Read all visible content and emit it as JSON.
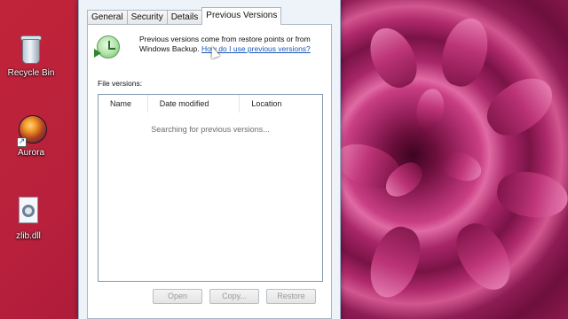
{
  "desktop": {
    "icons": [
      {
        "label": "Recycle Bin",
        "icon": "recycle-bin-icon"
      },
      {
        "label": "Aurora",
        "icon": "aurora-app-icon"
      },
      {
        "label": "zlib.dll",
        "icon": "dll-file-icon"
      }
    ],
    "wallpaper_colors": [
      "#b8203b",
      "#9c2460",
      "#e06aa3"
    ]
  },
  "window": {
    "tabs": [
      {
        "label": "General",
        "active": false
      },
      {
        "label": "Security",
        "active": false
      },
      {
        "label": "Details",
        "active": false
      },
      {
        "label": "Previous Versions",
        "active": true
      }
    ],
    "intro_text": "Previous versions come from restore points or from Windows Backup.",
    "intro_link": "How do I use previous versions?",
    "file_versions_label": "File versions:",
    "columns": [
      "Name",
      "Date modified",
      "Location"
    ],
    "status_text": "Searching for previous versions...",
    "buttons": {
      "open": "Open",
      "copy": "Copy...",
      "restore": "Restore"
    },
    "buttons_enabled": false
  }
}
